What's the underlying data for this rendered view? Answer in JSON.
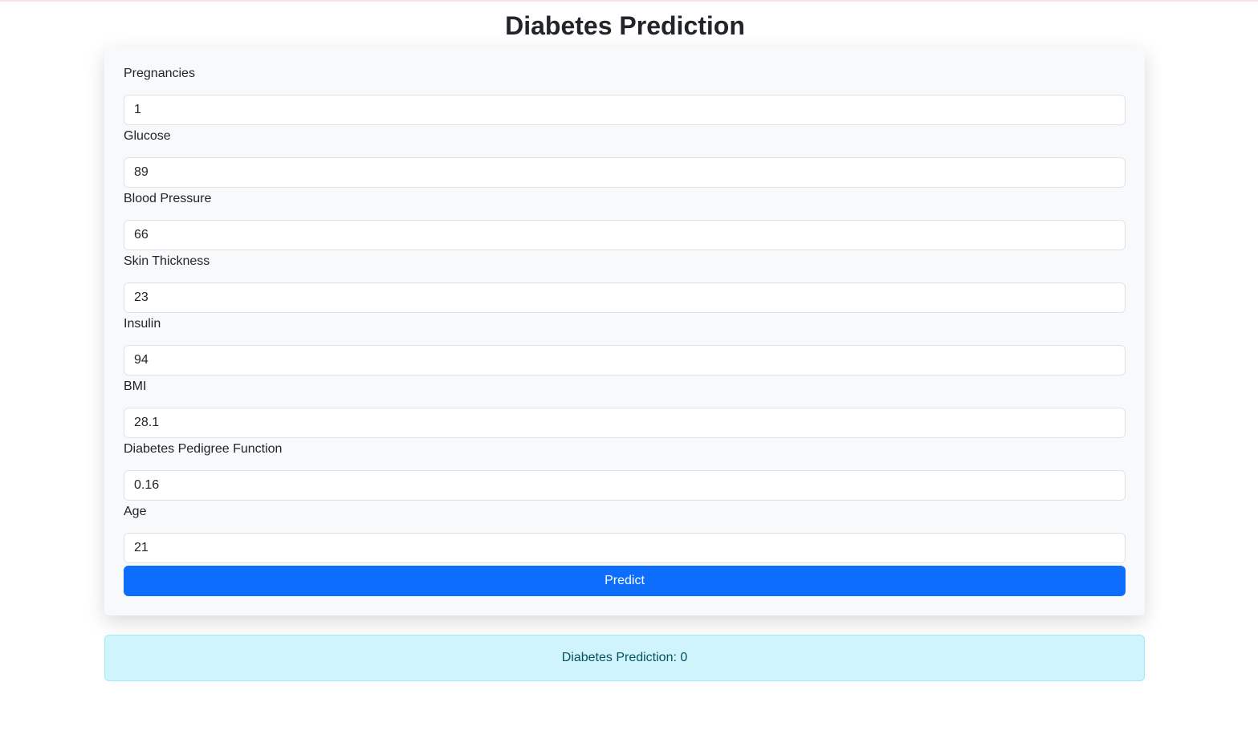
{
  "page": {
    "title": "Diabetes Prediction"
  },
  "form": {
    "fields": [
      {
        "label": "Pregnancies",
        "value": "1"
      },
      {
        "label": "Glucose",
        "value": "89"
      },
      {
        "label": "Blood Pressure",
        "value": "66"
      },
      {
        "label": "Skin Thickness",
        "value": "23"
      },
      {
        "label": "Insulin",
        "value": "94"
      },
      {
        "label": "BMI",
        "value": "28.1"
      },
      {
        "label": "Diabetes Pedigree Function",
        "value": "0.16"
      },
      {
        "label": "Age",
        "value": "21"
      }
    ],
    "submit_label": "Predict"
  },
  "result": {
    "text": "Diabetes Prediction: 0"
  },
  "colors": {
    "primary_button": "#0d6efd",
    "alert_background": "#cff4fc",
    "alert_text": "#055160",
    "card_background": "#f8f9fa"
  }
}
